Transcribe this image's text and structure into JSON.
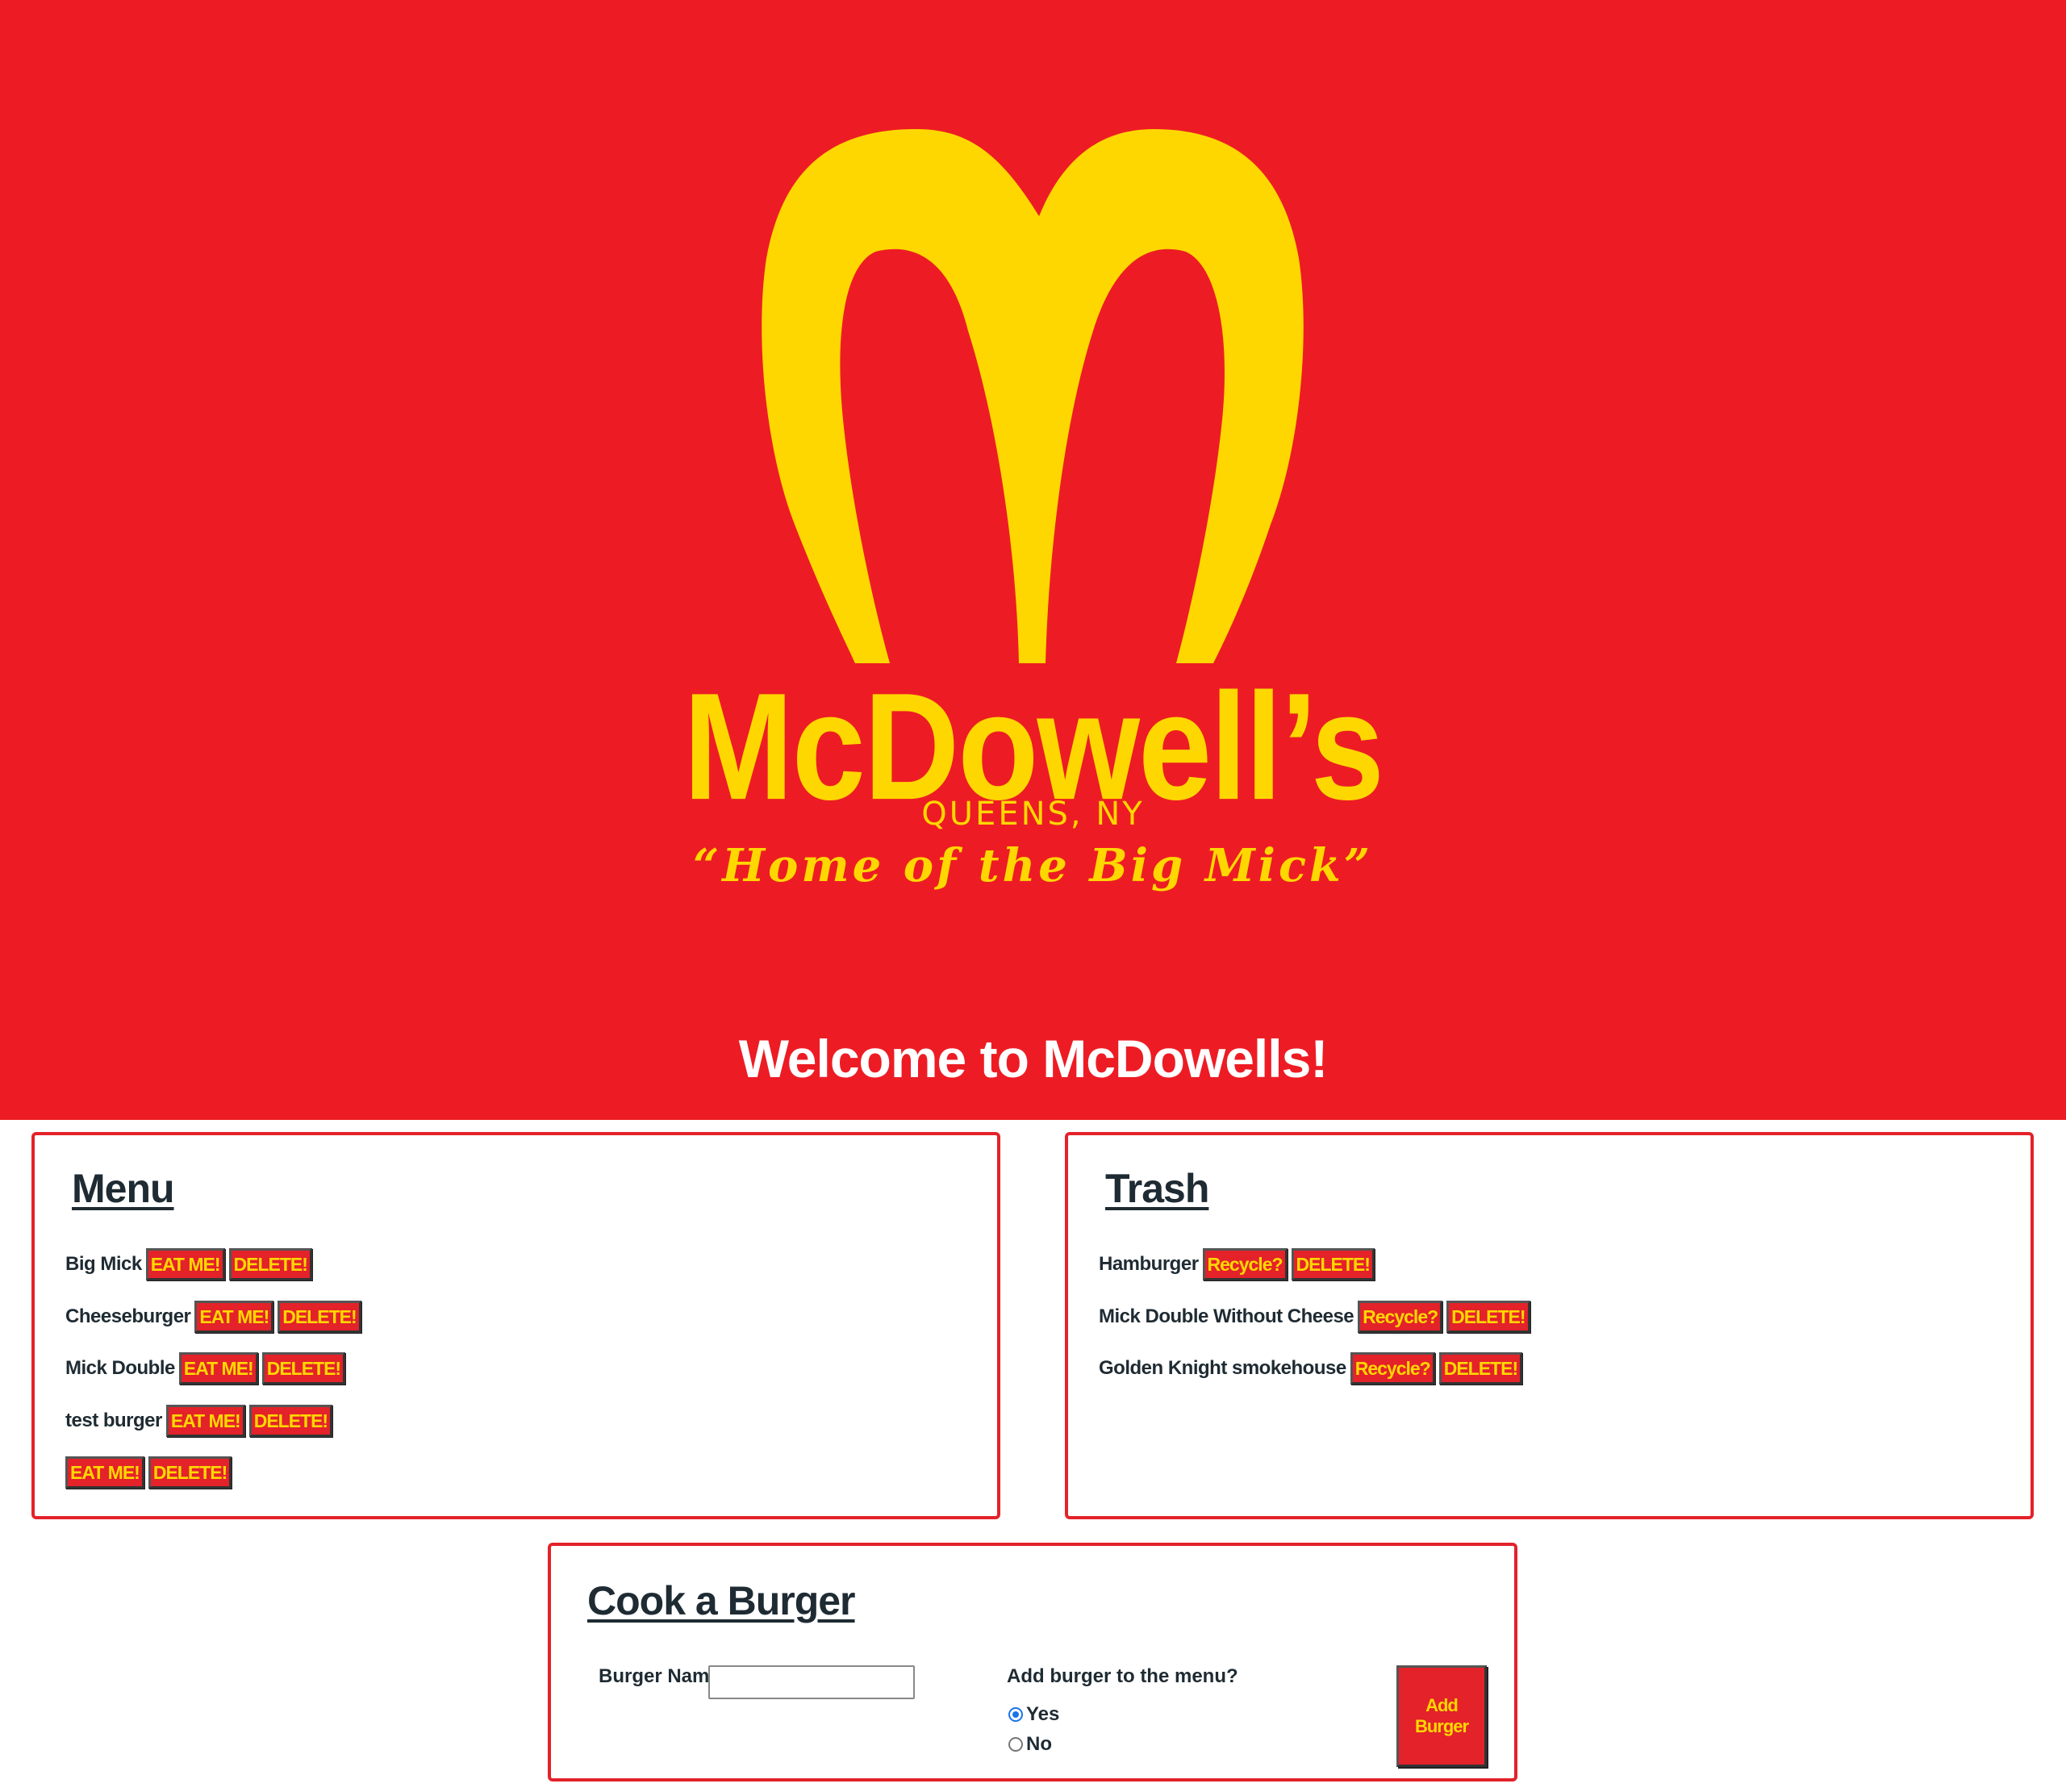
{
  "brand": {
    "name": "McDowell’s",
    "location": "QUEENS, NY",
    "tagline": "“Home of the Big Mick”",
    "primary_color": "#ED1C24",
    "accent_color": "#FFD700"
  },
  "welcome_text": "Welcome to McDowells!",
  "menu": {
    "title": "Menu",
    "items": [
      {
        "name": "Big Mick",
        "eat_label": "EAT ME!",
        "delete_label": "DELETE!"
      },
      {
        "name": "Cheeseburger",
        "eat_label": "EAT ME!",
        "delete_label": "DELETE!"
      },
      {
        "name": "Mick Double",
        "eat_label": "EAT ME!",
        "delete_label": "DELETE!"
      },
      {
        "name": "test burger",
        "eat_label": "EAT ME!",
        "delete_label": "DELETE!"
      },
      {
        "name": "",
        "eat_label": "EAT ME!",
        "delete_label": "DELETE!"
      }
    ]
  },
  "trash": {
    "title": "Trash",
    "items": [
      {
        "name": "Hamburger",
        "recycle_label": "Recycle?",
        "delete_label": "DELETE!"
      },
      {
        "name": "Mick Double Without Cheese",
        "recycle_label": "Recycle?",
        "delete_label": "DELETE!"
      },
      {
        "name": "Golden Knight smokehouse",
        "recycle_label": "Recycle?",
        "delete_label": "DELETE!"
      }
    ]
  },
  "cook": {
    "title": "Cook a Burger",
    "name_label": "Burger Name:",
    "name_value": "",
    "question": "Add burger to the menu?",
    "options": [
      {
        "label": "Yes",
        "checked": true
      },
      {
        "label": "No",
        "checked": false
      }
    ],
    "submit_label": "Add Burger"
  }
}
